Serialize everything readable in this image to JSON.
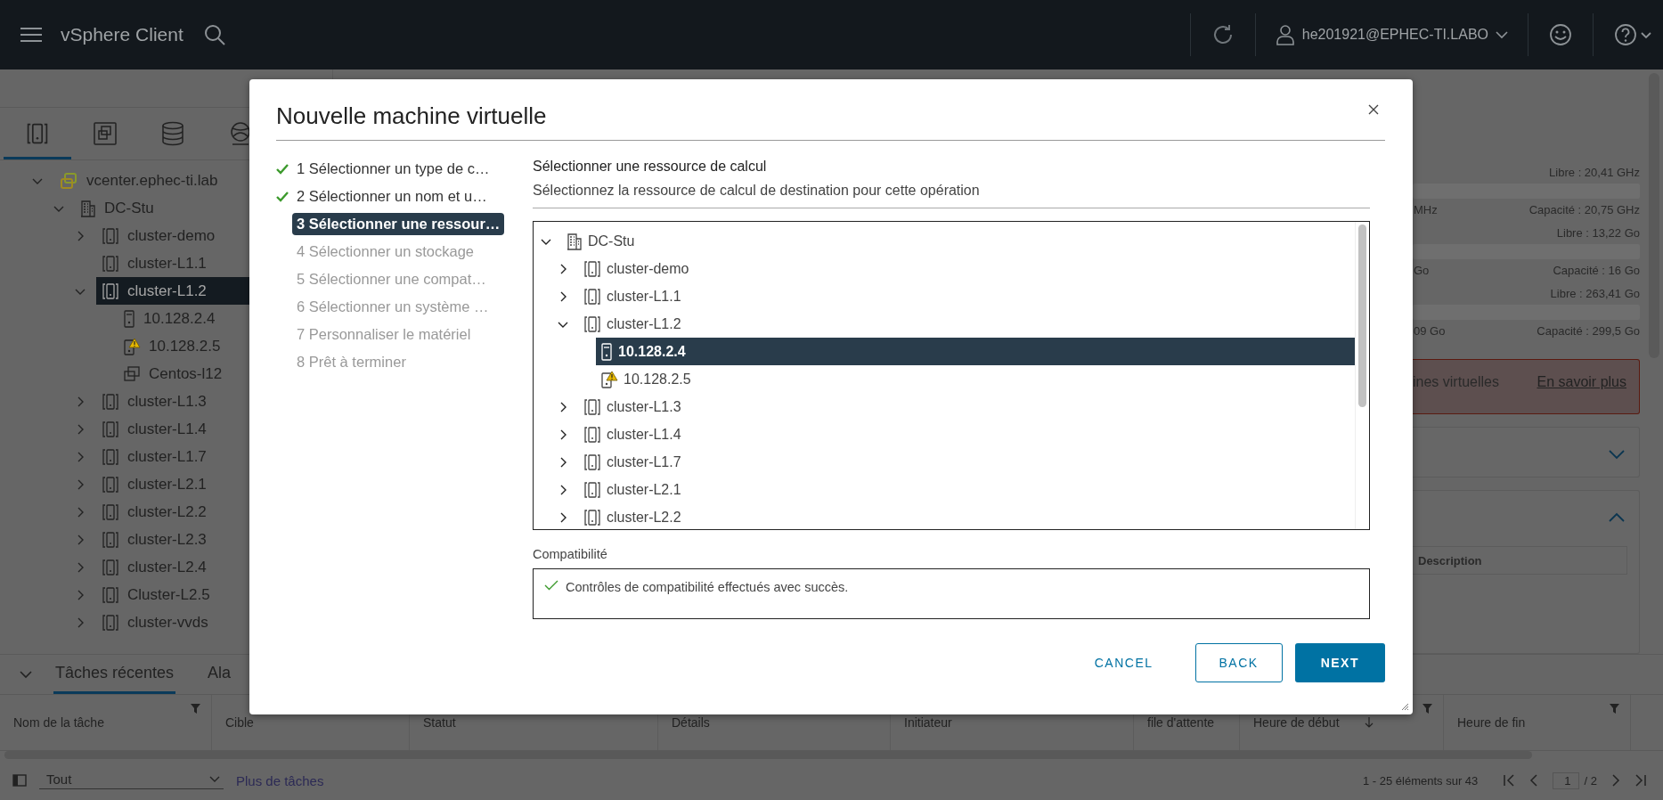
{
  "header": {
    "title": "vSphere Client",
    "user": "he201921@EPHEC-TI.LABO"
  },
  "inventory": {
    "tabs": [
      {
        "kind": "hosts",
        "selected": true
      },
      {
        "kind": "vms",
        "selected": false
      },
      {
        "kind": "storage",
        "selected": false
      },
      {
        "kind": "network",
        "selected": false
      }
    ],
    "tree": [
      {
        "label": "vcenter.ephec-ti.lab",
        "kind": "vcenter",
        "expanded": true,
        "selected": false,
        "children": [
          {
            "label": "DC-Stu",
            "kind": "datacenter",
            "expanded": true,
            "selected": false,
            "children": [
              {
                "label": "cluster-demo",
                "kind": "cluster",
                "expanded": false,
                "selected": false
              },
              {
                "label": "cluster-L1.1",
                "kind": "cluster",
                "selected": false
              },
              {
                "label": "cluster-L1.2",
                "kind": "cluster",
                "expanded": true,
                "selected": true,
                "children": [
                  {
                    "label": "10.128.2.4",
                    "kind": "host",
                    "selected": false
                  },
                  {
                    "label": "10.128.2.5",
                    "kind": "host-warning",
                    "selected": false
                  },
                  {
                    "label": "Centos-l12",
                    "kind": "vm",
                    "selected": false
                  }
                ]
              },
              {
                "label": "cluster-L1.3",
                "kind": "cluster",
                "expanded": false,
                "selected": false
              },
              {
                "label": "cluster-L1.4",
                "kind": "cluster",
                "expanded": false,
                "selected": false
              },
              {
                "label": "cluster-L1.7",
                "kind": "cluster",
                "expanded": false,
                "selected": false
              },
              {
                "label": "cluster-L2.1",
                "kind": "cluster",
                "expanded": false,
                "selected": false
              },
              {
                "label": "cluster-L2.2",
                "kind": "cluster",
                "expanded": false,
                "selected": false
              },
              {
                "label": "cluster-L2.3",
                "kind": "cluster",
                "expanded": false,
                "selected": false
              },
              {
                "label": "cluster-L2.4",
                "kind": "cluster",
                "expanded": false,
                "selected": false
              },
              {
                "label": "Cluster-L2.5",
                "kind": "cluster",
                "expanded": false,
                "selected": false
              },
              {
                "label": "cluster-vvds",
                "kind": "cluster",
                "expanded": false,
                "selected": false
              }
            ]
          }
        ]
      }
    ]
  },
  "summary": {
    "resources": [
      {
        "free": "Libre : 20,41 GHz",
        "used": "MHz",
        "capacity": "Capacité : 20,75 GHz"
      },
      {
        "free": "Libre : 13,22 Go",
        "used": "Go",
        "capacity": "Capacité : 16 Go"
      },
      {
        "free": "Libre : 263,41 Go",
        "used": "09 Go",
        "capacity": "Capacité : 299,5 Go"
      }
    ],
    "alert": {
      "text": "ines virtuelles",
      "link": "En savoir plus"
    },
    "panels": [
      {
        "expanded": false
      },
      {
        "expanded": true,
        "columns": [
          "Description"
        ]
      }
    ]
  },
  "tasks": {
    "tabs": [
      {
        "label": "Tâches récentes",
        "selected": true
      },
      {
        "label": "Ala",
        "selected": false
      }
    ],
    "columns": [
      {
        "label": "Nom de la tâche",
        "filter": true
      },
      {
        "label": "Cible"
      },
      {
        "label": "Statut"
      },
      {
        "label": "Détails"
      },
      {
        "label": "Initiateur"
      },
      {
        "label": "file d'attente"
      },
      {
        "label": "Heure de début",
        "filter": true,
        "sorted": true
      },
      {
        "label": "Heure de fin",
        "filter": true
      }
    ],
    "filter_value": "Tout",
    "more_link": "Plus de tâches",
    "count": "1 - 25 éléments sur 43",
    "page": "1",
    "pages": "/ 2"
  },
  "dialog": {
    "title": "Nouvelle machine virtuelle",
    "steps": [
      {
        "label": "1 Sélectionner un type de c…",
        "done": true,
        "selected": false,
        "disabled": false
      },
      {
        "label": "2 Sélectionner un nom et u…",
        "done": true,
        "selected": false,
        "disabled": false
      },
      {
        "label": "3 Sélectionner une ressour…",
        "done": false,
        "selected": true,
        "disabled": false
      },
      {
        "label": "4 Sélectionner un stockage",
        "done": false,
        "selected": false,
        "disabled": true
      },
      {
        "label": "5 Sélectionner une compat…",
        "done": false,
        "selected": false,
        "disabled": true
      },
      {
        "label": "6 Sélectionner un système …",
        "done": false,
        "selected": false,
        "disabled": true
      },
      {
        "label": "7 Personnaliser le matériel",
        "done": false,
        "selected": false,
        "disabled": true
      },
      {
        "label": "8 Prêt à terminer",
        "done": false,
        "selected": false,
        "disabled": true
      }
    ],
    "heading": "Sélectionner une ressource de calcul",
    "description": "Sélectionnez la ressource de calcul de destination pour cette opération",
    "tree": [
      {
        "label": "DC-Stu",
        "kind": "datacenter",
        "expanded": true,
        "selected": false,
        "children": [
          {
            "label": "cluster-demo",
            "kind": "cluster",
            "expanded": false,
            "selected": false
          },
          {
            "label": "cluster-L1.1",
            "kind": "cluster",
            "expanded": false,
            "selected": false
          },
          {
            "label": "cluster-L1.2",
            "kind": "cluster",
            "expanded": true,
            "selected": false,
            "children": [
              {
                "label": "10.128.2.4",
                "kind": "host",
                "selected": true
              },
              {
                "label": "10.128.2.5",
                "kind": "host-warning",
                "selected": false
              }
            ]
          },
          {
            "label": "cluster-L1.3",
            "kind": "cluster",
            "expanded": false,
            "selected": false
          },
          {
            "label": "cluster-L1.4",
            "kind": "cluster",
            "expanded": false,
            "selected": false
          },
          {
            "label": "cluster-L1.7",
            "kind": "cluster",
            "expanded": false,
            "selected": false
          },
          {
            "label": "cluster-L2.1",
            "kind": "cluster",
            "expanded": false,
            "selected": false
          },
          {
            "label": "cluster-L2.2",
            "kind": "cluster",
            "expanded": false,
            "selected": false
          }
        ]
      }
    ],
    "compat_label": "Compatibilité",
    "compat_ok": true,
    "compat_message": "Contrôles de compatibilité effectués avec succès.",
    "buttons": [
      {
        "label": "CANCEL",
        "kind": "flat"
      },
      {
        "label": "BACK",
        "kind": "outline"
      },
      {
        "label": "NEXT",
        "kind": "primary"
      }
    ]
  }
}
